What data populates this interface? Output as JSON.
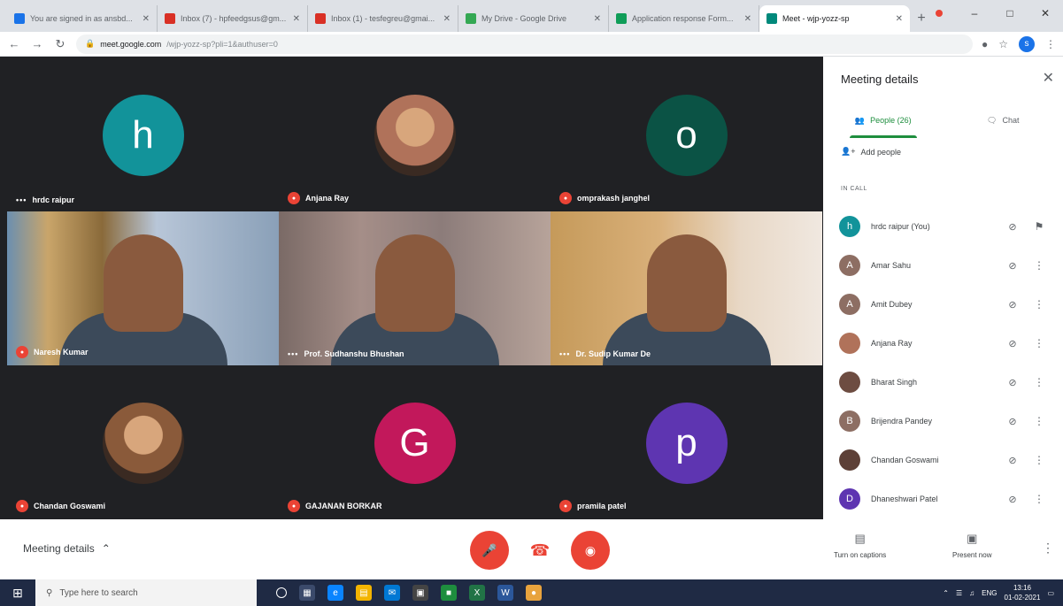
{
  "browser": {
    "tabs": [
      {
        "title": "You are signed in as ansbd...",
        "color": "#1a73e8"
      },
      {
        "title": "Inbox (7) - hpfeedgsus@gm...",
        "color": "#d93025"
      },
      {
        "title": "Inbox (1) - tesfegreu@gmai...",
        "color": "#d93025"
      },
      {
        "title": "My Drive - Google Drive",
        "color": "#34a853"
      },
      {
        "title": "Application response Form...",
        "color": "#0f9d58"
      },
      {
        "title": "Meet - wjp-yozz-sp",
        "color": "#00897b"
      }
    ],
    "url_host": "meet.google.com",
    "url_path": "/wjp-yozz-sp?pli=1&authuser=0",
    "profile_initial": "s"
  },
  "tiles": [
    {
      "name": "hrdc raipur",
      "initial": "h",
      "avatar_color": "#12939a",
      "indicator": "more",
      "kind": "letter"
    },
    {
      "name": "Anjana Ray",
      "initial": "",
      "avatar_color": "#b0725a",
      "indicator": "mic-off",
      "kind": "photo"
    },
    {
      "name": "omprakash janghel",
      "initial": "o",
      "avatar_color": "#0b5345",
      "indicator": "mic-off",
      "kind": "letter"
    },
    {
      "name": "Naresh Kumar",
      "initial": "",
      "avatar_color": "",
      "indicator": "mic-off",
      "kind": "video-a"
    },
    {
      "name": "Prof. Sudhanshu Bhushan",
      "initial": "",
      "avatar_color": "",
      "indicator": "more",
      "kind": "video-b"
    },
    {
      "name": "Dr. Sudip Kumar De",
      "initial": "",
      "avatar_color": "",
      "indicator": "more",
      "kind": "video-c"
    },
    {
      "name": "Chandan Goswami",
      "initial": "",
      "avatar_color": "#8a5a3a",
      "indicator": "mic-off",
      "kind": "photo"
    },
    {
      "name": "GAJANAN BORKAR",
      "initial": "G",
      "avatar_color": "#c2185b",
      "indicator": "mic-off",
      "kind": "letter"
    },
    {
      "name": "pramila patel",
      "initial": "p",
      "avatar_color": "#5e35b1",
      "indicator": "mic-off",
      "kind": "letter"
    }
  ],
  "panel": {
    "title": "Meeting details",
    "tab_people": "People (26)",
    "tab_chat": "Chat",
    "add_people": "Add people",
    "section": "IN CALL",
    "participants": [
      {
        "name": "hrdc raipur (You)",
        "initial": "h",
        "color": "#12939a",
        "action": "pin"
      },
      {
        "name": "Amar Sahu",
        "initial": "A",
        "color": "#8d6e63",
        "action": "more"
      },
      {
        "name": "Amit Dubey",
        "initial": "A",
        "color": "#8d6e63",
        "action": "more"
      },
      {
        "name": "Anjana Ray",
        "initial": "",
        "color": "#b0725a",
        "action": "more"
      },
      {
        "name": "Bharat Singh",
        "initial": "",
        "color": "#6d4c41",
        "action": "more"
      },
      {
        "name": "Brijendra Pandey",
        "initial": "B",
        "color": "#8d6e63",
        "action": "more"
      },
      {
        "name": "Chandan Goswami",
        "initial": "",
        "color": "#5d4037",
        "action": "more"
      },
      {
        "name": "Dhaneshwari Patel",
        "initial": "D",
        "color": "#5e35b1",
        "action": "more"
      }
    ]
  },
  "controls": {
    "meeting_details": "Meeting details",
    "captions": "Turn on captions",
    "present": "Present now"
  },
  "taskbar": {
    "search_placeholder": "Type here to search",
    "lang": "ENG",
    "time": "13:16",
    "date": "01-02-2021"
  }
}
